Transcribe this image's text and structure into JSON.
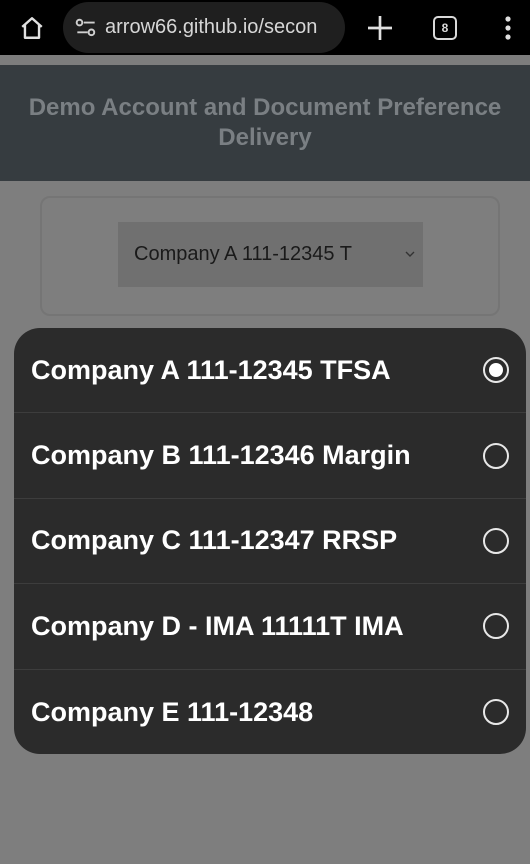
{
  "browser": {
    "url": "arrow66.github.io/secon",
    "tab_count": "8"
  },
  "page": {
    "title": "Demo Account and Document Preference Delivery",
    "select_value": "Company A 111-12345 T"
  },
  "dropdown": {
    "options": [
      {
        "label": "Company A 111-12345 TFSA",
        "selected": true
      },
      {
        "label": "Company B 111-12346 Margin",
        "selected": false
      },
      {
        "label": "Company C 111-12347 RRSP",
        "selected": false
      },
      {
        "label": "Company D - IMA 11111T IMA",
        "selected": false
      },
      {
        "label": "Company E 111-12348",
        "selected": false
      }
    ]
  },
  "icons": {
    "home": "home-icon",
    "site_settings": "tune-icon",
    "new_tab": "plus-icon",
    "tabs": "tab-switcher-icon",
    "menu": "more-vert-icon"
  }
}
